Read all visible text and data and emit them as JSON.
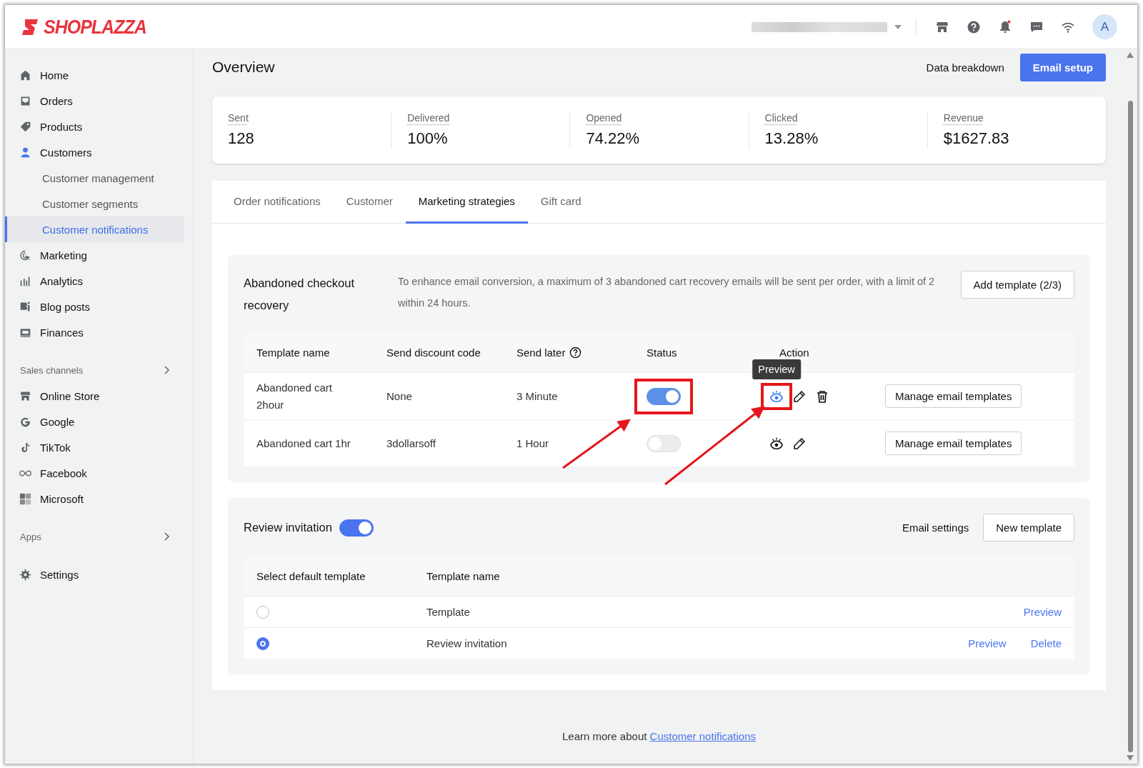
{
  "header": {
    "logo": "SHOPLAZZA",
    "avatar": "A"
  },
  "sidebar": {
    "items": [
      {
        "label": "Home",
        "kind": "item",
        "selected": false
      },
      {
        "label": "Orders",
        "kind": "item",
        "selected": false
      },
      {
        "label": "Products",
        "kind": "item",
        "selected": false
      },
      {
        "label": "Customers",
        "kind": "item",
        "selected": false
      },
      {
        "label": "Customer management",
        "kind": "sub",
        "selected": false
      },
      {
        "label": "Customer segments",
        "kind": "sub",
        "selected": false
      },
      {
        "label": "Customer notifications",
        "kind": "sub",
        "selected": true
      },
      {
        "label": "Marketing",
        "kind": "item",
        "selected": false
      },
      {
        "label": "Analytics",
        "kind": "item",
        "selected": false
      },
      {
        "label": "Blog posts",
        "kind": "item",
        "selected": false
      },
      {
        "label": "Finances",
        "kind": "item",
        "selected": false
      },
      {
        "label": "Sales channels",
        "kind": "section",
        "selected": false
      },
      {
        "label": "Online Store",
        "kind": "item",
        "selected": false
      },
      {
        "label": "Google",
        "kind": "item",
        "selected": false
      },
      {
        "label": "TikTok",
        "kind": "item",
        "selected": false
      },
      {
        "label": "Facebook",
        "kind": "item",
        "selected": false
      },
      {
        "label": "Microsoft",
        "kind": "item",
        "selected": false
      },
      {
        "label": "Apps",
        "kind": "section",
        "selected": false
      },
      {
        "label": "Settings",
        "kind": "item",
        "selected": false
      }
    ]
  },
  "page": {
    "title": "Overview",
    "secondary_action": "Data breakdown",
    "primary_action": "Email setup"
  },
  "stats": [
    {
      "label": "Sent",
      "value": "128"
    },
    {
      "label": "Delivered",
      "value": "100%"
    },
    {
      "label": "Opened",
      "value": "74.22%"
    },
    {
      "label": "Clicked",
      "value": "13.28%"
    },
    {
      "label": "Revenue",
      "value": "$1627.83"
    }
  ],
  "tabs": [
    {
      "label": "Order notifications",
      "selected": false
    },
    {
      "label": "Customer",
      "selected": false
    },
    {
      "label": "Marketing strategies",
      "selected": true
    },
    {
      "label": "Gift card",
      "selected": false
    }
  ],
  "abandoned": {
    "title": "Abandoned checkout recovery",
    "description": "To enhance email conversion, a maximum of 3 abandoned cart recovery emails will be sent per order, with a limit of 2 within 24 hours.",
    "button": "Add template (2/3)",
    "columns": [
      "Template name",
      "Send discount code",
      "Send later",
      "Status",
      "Action"
    ],
    "tooltip": "Preview",
    "rows": [
      {
        "name": "Abandoned cart 2hour",
        "discount": "None",
        "delay": "3 Minute",
        "enabled": true,
        "can_delete": true,
        "annotated": true,
        "button": "Manage email templates"
      },
      {
        "name": "Abandoned cart 1hr",
        "discount": "3dollarsoff",
        "delay": "1 Hour",
        "enabled": false,
        "can_delete": false,
        "annotated": false,
        "button": "Manage email templates"
      }
    ]
  },
  "review": {
    "title": "Review invitation",
    "enabled": true,
    "settings_link": "Email settings",
    "button": "New template",
    "columns": [
      "Select default template",
      "Template name"
    ],
    "rows": [
      {
        "name": "Template",
        "selected": false,
        "links": [
          "Preview"
        ]
      },
      {
        "name": "Review invitation",
        "selected": true,
        "links": [
          "Preview",
          "Delete"
        ]
      }
    ]
  },
  "footer": {
    "text": "Learn more about",
    "link": "Customer notifications"
  }
}
